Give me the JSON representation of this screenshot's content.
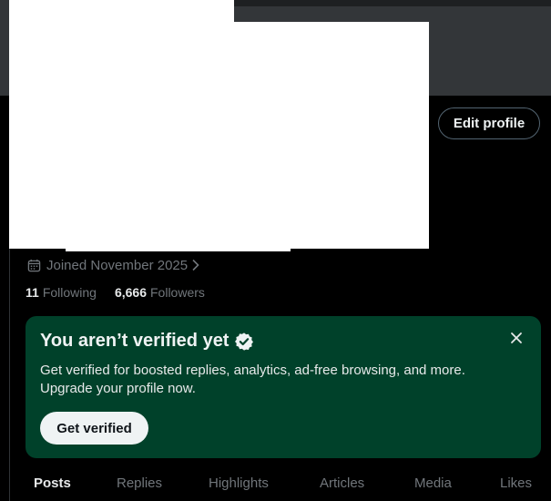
{
  "profile": {
    "edit_profile_label": "Edit profile",
    "joined_text": "Joined November 2025",
    "following_count": "11",
    "following_label": "Following",
    "followers_count": "6,666",
    "followers_label": "Followers"
  },
  "verify_card": {
    "title": "You aren’t verified yet",
    "description_line1": "Get verified for boosted replies, analytics, ad-free browsing, and more.",
    "description_line2": "Upgrade your profile now.",
    "button_label": "Get verified"
  },
  "tabs": [
    {
      "label": "Posts",
      "active": true
    },
    {
      "label": "Replies",
      "active": false
    },
    {
      "label": "Highlights",
      "active": false
    },
    {
      "label": "Articles",
      "active": false
    },
    {
      "label": "Media",
      "active": false
    },
    {
      "label": "Likes",
      "active": false
    }
  ],
  "icons": {
    "calendar": "calendar-icon",
    "chevron": "chevron-right-icon",
    "verified": "verified-badge-icon",
    "close": "close-icon"
  },
  "colors": {
    "background": "#000000",
    "banner": "#333639",
    "card_background": "#00412a",
    "muted_text": "#71767b",
    "primary_text": "#e7e9ea",
    "button_light": "#eff3f4"
  }
}
